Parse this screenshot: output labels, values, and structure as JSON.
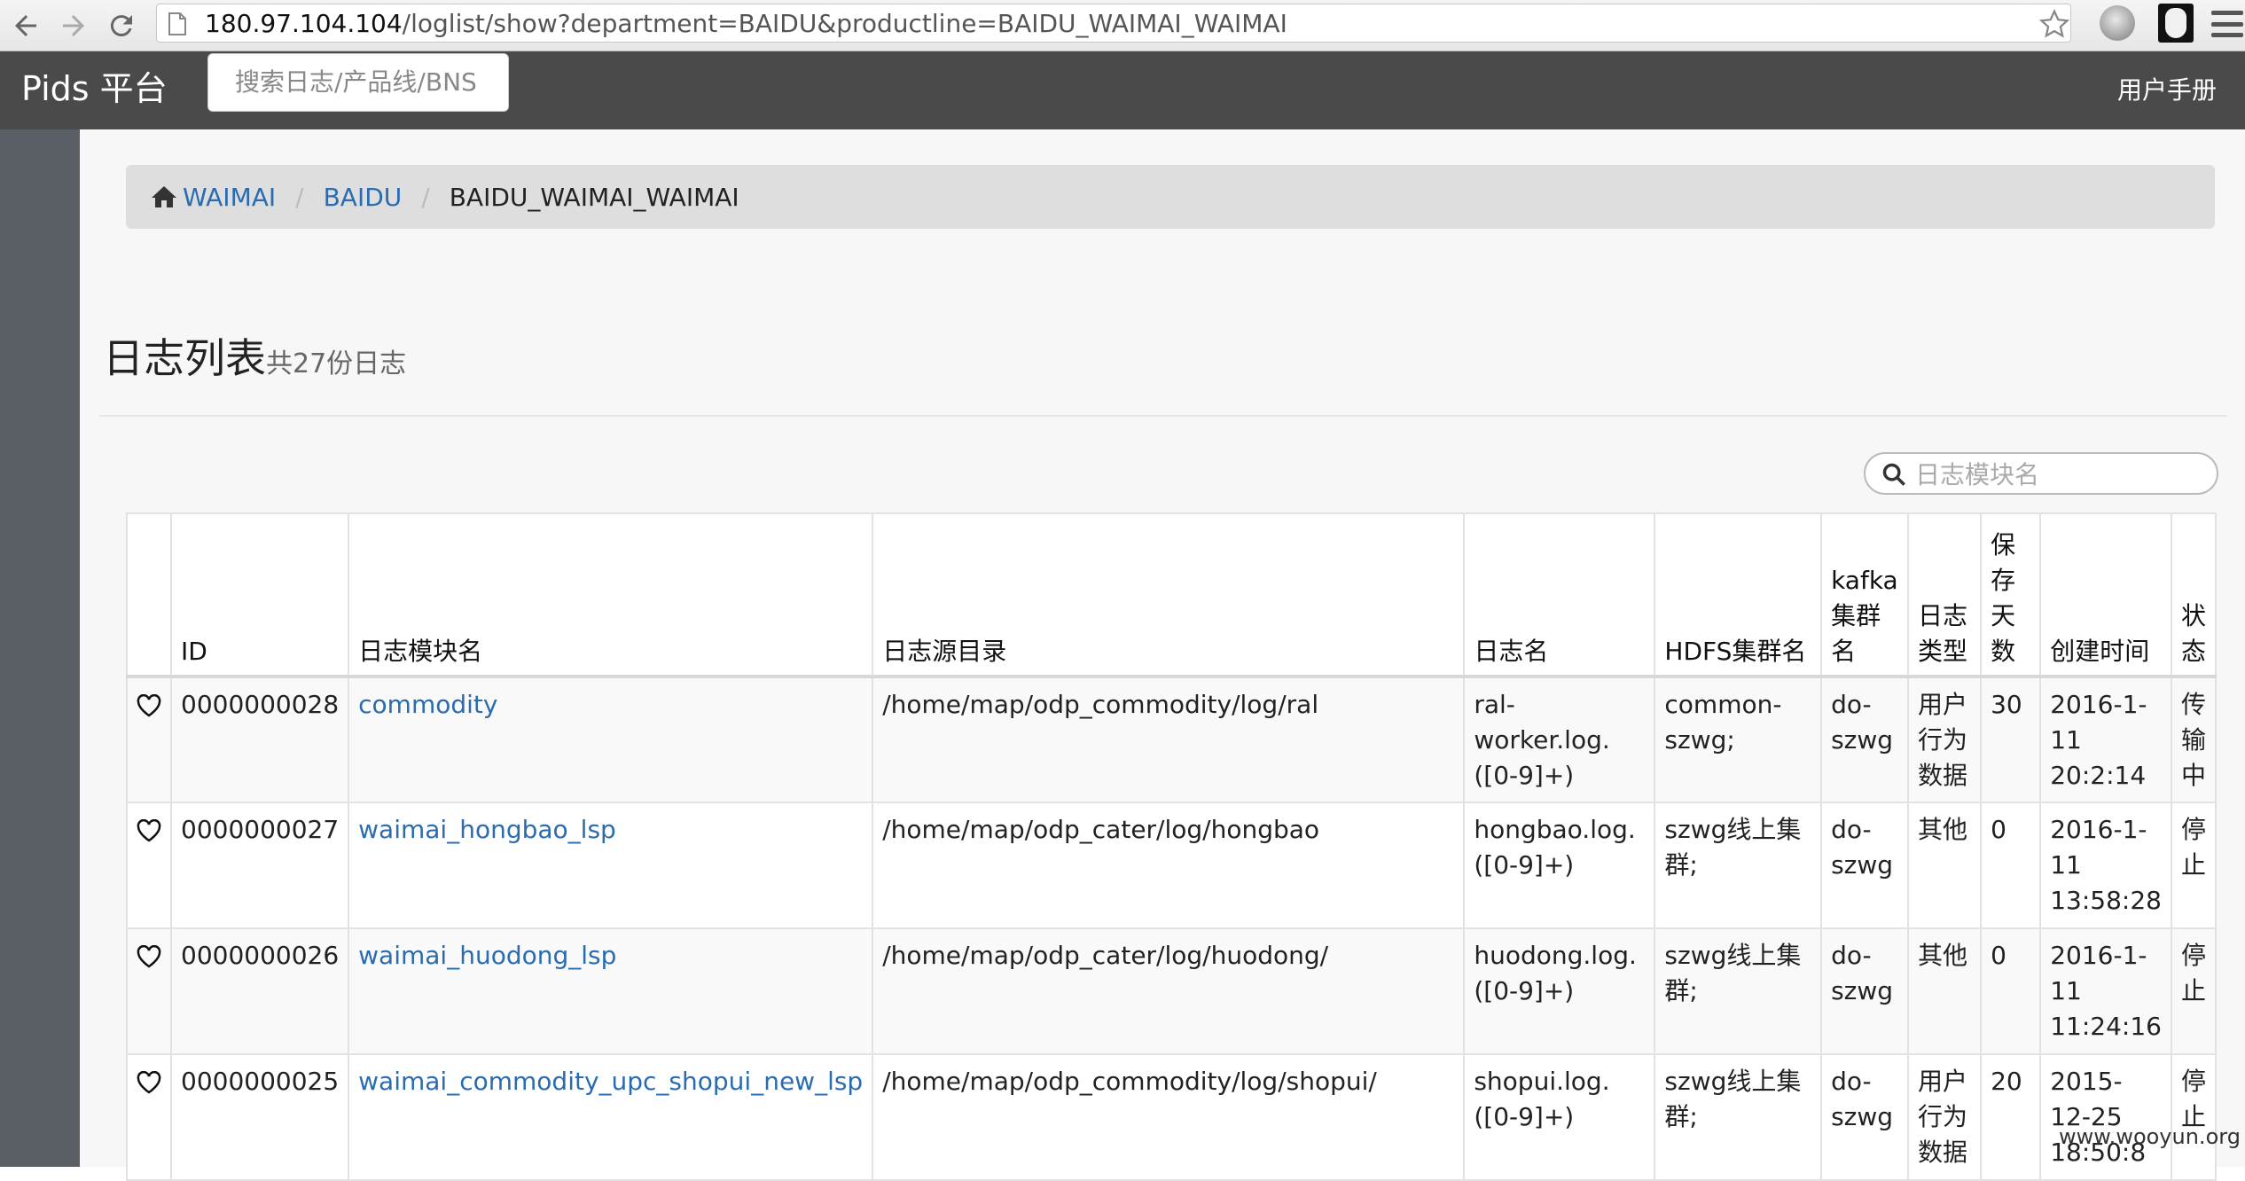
{
  "browser": {
    "url_host": "180.97.104.104",
    "url_path": "/loglist/show?department=BAIDU&productline=BAIDU_WAIMAI_WAIMAI"
  },
  "navbar": {
    "brand": "Pids 平台",
    "search_placeholder": "搜索日志/产品线/BNS",
    "manual_label": "用户手册"
  },
  "breadcrumb": {
    "items": [
      "WAIMAI",
      "BAIDU"
    ],
    "current": "BAIDU_WAIMAI_WAIMAI",
    "separator": "/"
  },
  "page": {
    "title": "日志列表",
    "subtitle": "共27份日志"
  },
  "filter": {
    "placeholder": "日志模块名"
  },
  "table": {
    "headers": [
      "",
      "ID",
      "日志模块名",
      "日志源目录",
      "日志名",
      "HDFS集群名",
      "kafka集群名",
      "日志类型",
      "保存天数",
      "创建时间",
      "状态"
    ],
    "rows": [
      {
        "id": "0000000028",
        "module": "commodity",
        "source": "/home/map/odp_commodity/log/ral",
        "logname": "ral-worker.log.([0-9]+)",
        "hdfs": "common-szwg;",
        "kafka": "do-szwg",
        "type": "用户行为数据",
        "days": "30",
        "created": "2016-1-11 20:2:14",
        "status": "传输中"
      },
      {
        "id": "0000000027",
        "module": "waimai_hongbao_lsp",
        "source": "/home/map/odp_cater/log/hongbao",
        "logname": "hongbao.log.([0-9]+)",
        "hdfs": "szwg线上集群;",
        "kafka": "do-szwg",
        "type": "其他",
        "days": "0",
        "created": "2016-1-11 13:58:28",
        "status": "停止"
      },
      {
        "id": "0000000026",
        "module": "waimai_huodong_lsp",
        "source": "/home/map/odp_cater/log/huodong/",
        "logname": "huodong.log.([0-9]+)",
        "hdfs": "szwg线上集群;",
        "kafka": "do-szwg",
        "type": "其他",
        "days": "0",
        "created": "2016-1-11 11:24:16",
        "status": "停止"
      },
      {
        "id": "0000000025",
        "module": "waimai_commodity_upc_shopui_new_lsp",
        "source": "/home/map/odp_commodity/log/shopui/",
        "logname": "shopui.log.([0-9]+)",
        "hdfs": "szwg线上集群;",
        "kafka": "do-szwg",
        "type": "用户行为数据",
        "days": "20",
        "created": "2015-12-25 18:50:8",
        "status": "停止"
      }
    ]
  },
  "watermark": "www.wooyun.org",
  "colors": {
    "navbar_bg": "#4a4a4a",
    "link": "#2b6cb0",
    "rail": "#5a5f66"
  }
}
